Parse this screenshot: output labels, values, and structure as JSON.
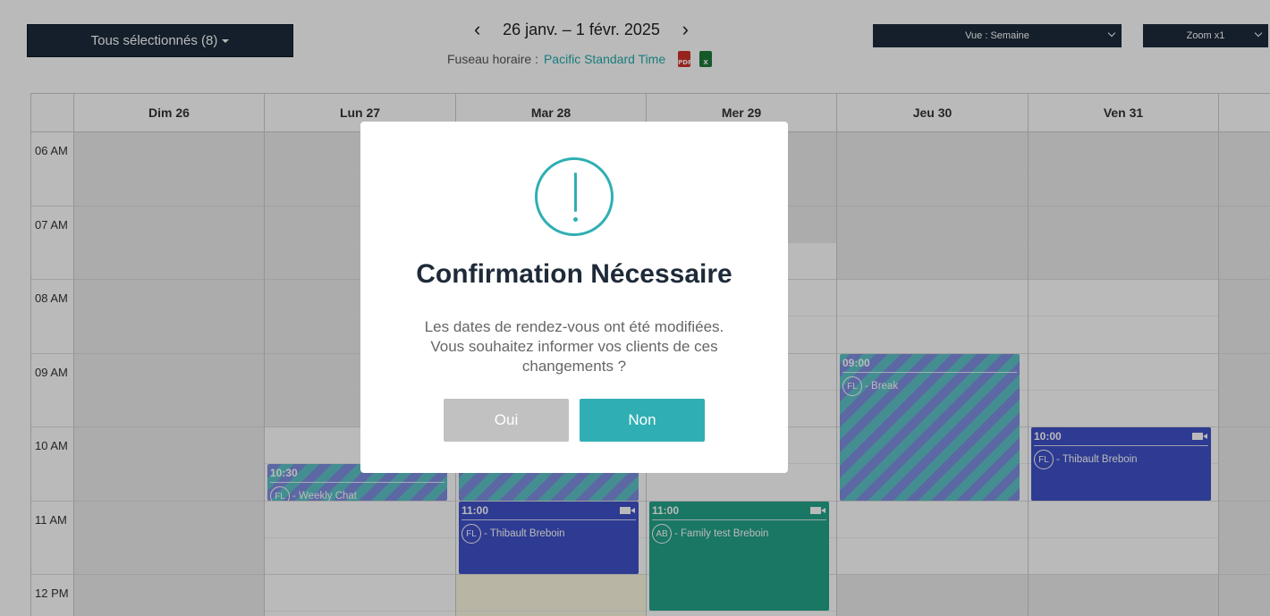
{
  "toolbar": {
    "selection_label": "Tous sélectionnés (8)",
    "date_range": "26 janv. – 1 févr. 2025",
    "timezone_label": "Fuseau horaire :",
    "timezone_value": "Pacific Standard Time",
    "pdf_icon": "PDF",
    "xls_icon": "X",
    "view_select": "Vue : Semaine",
    "zoom_select": "Zoom x1"
  },
  "calendar": {
    "days": [
      "Dim 26",
      "Lun 27",
      "Mar 28",
      "Mer 29",
      "Jeu 30",
      "Ven 31",
      ""
    ],
    "hours": [
      "06 AM",
      "07 AM",
      "08 AM",
      "09 AM",
      "10 AM",
      "11 AM",
      "12 PM"
    ],
    "events": [
      {
        "time": "10:30",
        "initials": "FL",
        "title": "- Weekly Chat"
      },
      {
        "time": "11:00",
        "initials": "FL",
        "title": "- Thibault Breboin"
      },
      {
        "time": "11:00",
        "initials": "AB",
        "title": "- Family test Breboin"
      },
      {
        "time": "09:00",
        "initials": "FL",
        "title": "- Break"
      },
      {
        "time": "10:00",
        "initials": "FL",
        "title": "- Thibault Breboin"
      }
    ]
  },
  "modal": {
    "title": "Confirmation Nécessaire",
    "message": "Les dates de rendez-vous ont été modifiées. Vous souhaitez informer vos clients de ces changements ?",
    "yes_label": "Oui",
    "no_label": "Non"
  },
  "colors": {
    "accent": "#2fafb3",
    "navy": "#1c2b3c",
    "event_blue": "#3f51c8",
    "event_green": "#23a38a"
  }
}
